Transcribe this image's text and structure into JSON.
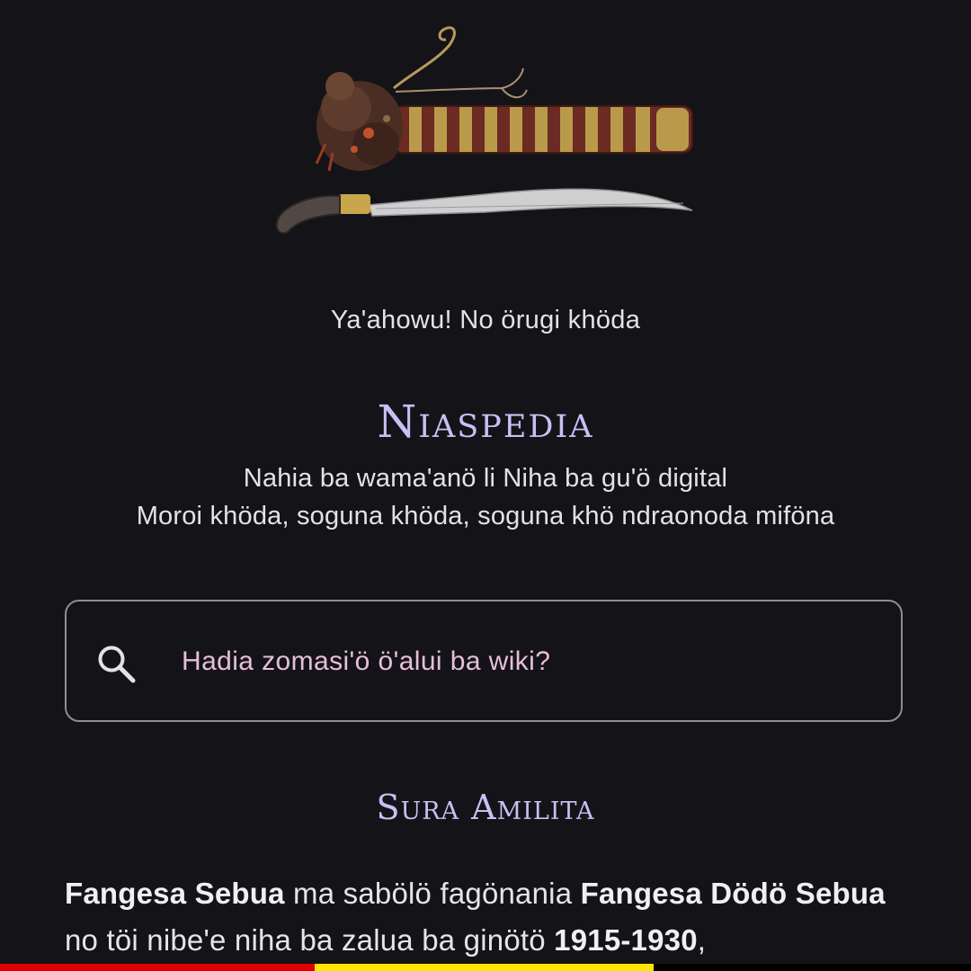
{
  "greeting": "Ya'ahowu! No örugi khöda",
  "site": {
    "title": "Niaspedia",
    "tagline_line1": "Nahia ba wama'anö li Niha ba gu'ö digital",
    "tagline_line2": "Moroi khöda, soguna khöda, soguna khö ndraonoda miföna"
  },
  "search": {
    "icon": "search-icon",
    "placeholder": "Hadia zomasi'ö ö'alui ba wiki?"
  },
  "featured": {
    "heading": "Sura Amilita",
    "segments": [
      {
        "text": "Fangesa Sebua",
        "bold": true
      },
      {
        "text": " ma sabölö fagönania ",
        "bold": false
      },
      {
        "text": "Fangesa Dödö Sebua",
        "bold": true
      },
      {
        "text": " no töi nibe'e niha ba zalua ba ginötö ",
        "bold": false
      },
      {
        "text": "1915-1930",
        "bold": true
      },
      {
        "text": ",",
        "bold": false
      }
    ]
  },
  "colors": {
    "background": "#141418",
    "accent": "#c5c1f5",
    "placeholder": "#e7bfd9",
    "flag": [
      "#e00000",
      "#ffe500",
      "#000000"
    ]
  }
}
